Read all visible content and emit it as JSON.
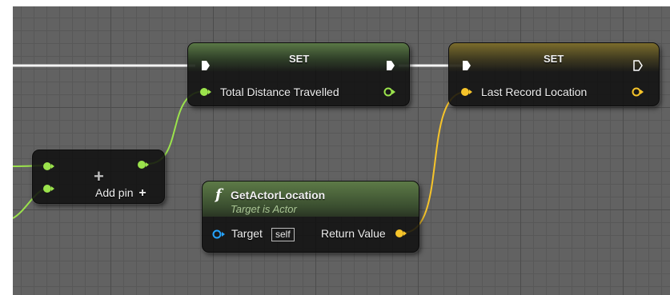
{
  "set_node_1": {
    "title": "SET",
    "variable_label": "Total Distance Travelled"
  },
  "set_node_2": {
    "title": "SET",
    "variable_label": "Last Record Location"
  },
  "add_node": {
    "add_pin_label": "Add pin"
  },
  "func_node": {
    "icon": "f",
    "title": "GetActorLocation",
    "subtitle": "Target is Actor",
    "target_label": "Target",
    "target_default": "self",
    "return_label": "Return Value"
  },
  "colors": {
    "exec_wire": "#f4f4f4",
    "float_pin": "#9be34c",
    "vector_pin": "#f6c42a",
    "object_pin": "#25a4ff"
  }
}
